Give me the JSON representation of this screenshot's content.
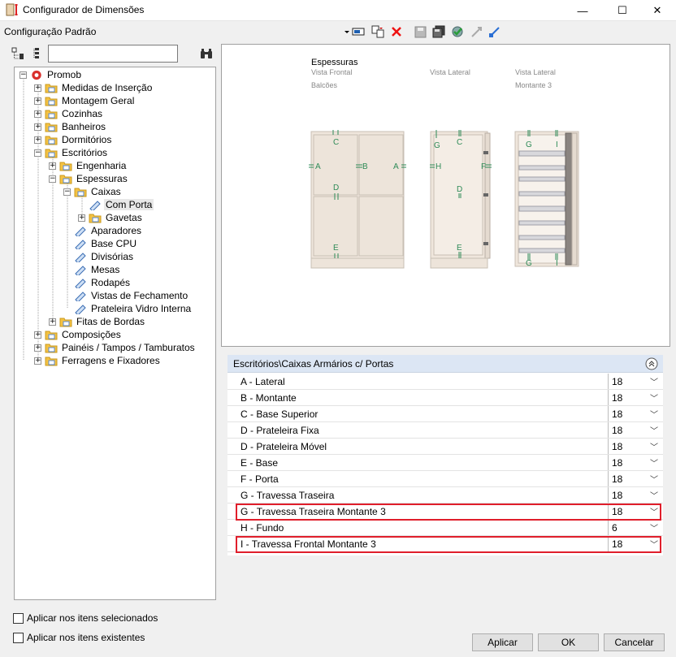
{
  "window": {
    "title": "Configurador de Dimensões",
    "minimize": "—",
    "maximize": "☐",
    "close": "✕"
  },
  "toolbar": {
    "config_name": "Configuração Padrão",
    "icons": [
      "dropdown-arrow-icon",
      "select-icon",
      "copy-icon",
      "delete-icon",
      "save-icon",
      "save-as-icon",
      "check-settings-icon",
      "import-icon",
      "export-icon"
    ]
  },
  "tree": {
    "search_value": "",
    "items": [
      {
        "label": "Promob"
      },
      {
        "label": "Medidas de Inserção"
      },
      {
        "label": "Montagem Geral"
      },
      {
        "label": "Cozinhas"
      },
      {
        "label": "Banheiros"
      },
      {
        "label": "Dormitórios"
      },
      {
        "label": "Escritórios"
      },
      {
        "label": "Engenharia"
      },
      {
        "label": "Espessuras"
      },
      {
        "label": "Caixas"
      },
      {
        "label": "Com Porta"
      },
      {
        "label": "Gavetas"
      },
      {
        "label": "Aparadores"
      },
      {
        "label": "Base CPU"
      },
      {
        "label": "Divisórias"
      },
      {
        "label": "Mesas"
      },
      {
        "label": "Rodapés"
      },
      {
        "label": "Vistas de Fechamento"
      },
      {
        "label": "Prateleira Vidro Interna"
      },
      {
        "label": "Fitas de Bordas"
      },
      {
        "label": "Composições"
      },
      {
        "label": "Painéis / Tampos / Tamburatos"
      },
      {
        "label": "Ferragens e Fixadores"
      }
    ]
  },
  "options": {
    "apply_selected": "Aplicar nos itens selecionados",
    "apply_existing": "Aplicar nos itens existentes"
  },
  "preview": {
    "heading": "Espessuras",
    "view_front": "Vista Frontal",
    "view_side": "Vista Lateral",
    "view_side2": "Vista Lateral",
    "subtitle_left": "Balcões",
    "subtitle_right": "Montante 3",
    "letters": {
      "A": "A",
      "B": "B",
      "C": "C",
      "D": "D",
      "E": "E",
      "F": "F",
      "G": "G",
      "H": "H",
      "I": "I"
    }
  },
  "properties": {
    "header": "Escritórios\\Caixas Armários c/ Portas",
    "rows": [
      {
        "name": "A - Lateral",
        "value": "18"
      },
      {
        "name": "B - Montante",
        "value": "18"
      },
      {
        "name": "C - Base Superior",
        "value": "18"
      },
      {
        "name": "D - Prateleira Fixa",
        "value": "18"
      },
      {
        "name": "D - Prateleira Móvel",
        "value": "18"
      },
      {
        "name": "E - Base",
        "value": "18"
      },
      {
        "name": "F - Porta",
        "value": "18"
      },
      {
        "name": "G - Travessa Traseira",
        "value": "18"
      },
      {
        "name": "G - Travessa Traseira Montante 3",
        "value": "18"
      },
      {
        "name": "H - Fundo",
        "value": "6"
      },
      {
        "name": "I - Travessa Frontal Montante 3",
        "value": "18"
      }
    ]
  },
  "buttons": {
    "apply": "Aplicar",
    "ok": "OK",
    "cancel": "Cancelar"
  },
  "colors": {
    "highlight": "#e01e2b",
    "header_bg": "#dce6f4",
    "folder": "#f5c242",
    "dimension_green": "#2e8b57"
  }
}
